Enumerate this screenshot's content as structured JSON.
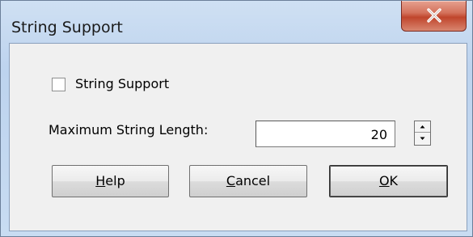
{
  "window": {
    "title": "String Support",
    "close_icon": "close-x-icon"
  },
  "form": {
    "string_support_label": "String Support",
    "string_support_checked": false,
    "max_length_label": "Maximum String Length:",
    "max_length_value": "20"
  },
  "buttons": {
    "help": {
      "mnemonic": "H",
      "rest": "elp"
    },
    "cancel": {
      "mnemonic": "C",
      "rest": "ancel"
    },
    "ok": {
      "mnemonic": "O",
      "rest": "K"
    }
  },
  "colors": {
    "close_button": "#c0452c",
    "frame": "#bdd3ee",
    "client": "#f0f0f0"
  }
}
